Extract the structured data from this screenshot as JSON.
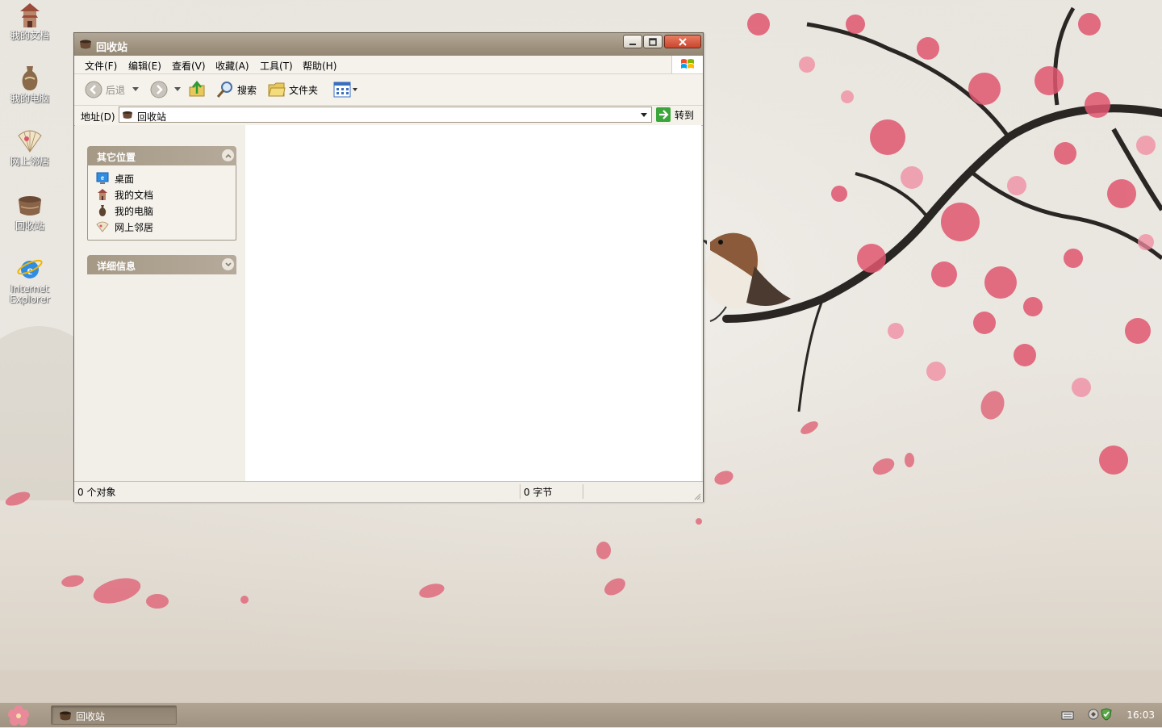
{
  "desktop": {
    "icons": [
      {
        "label": "我的文档"
      },
      {
        "label": "我的电脑"
      },
      {
        "label": "网上邻居"
      },
      {
        "label": "回收站"
      },
      {
        "label": "Internet Explorer"
      }
    ]
  },
  "window": {
    "title": "回收站",
    "menu": [
      "文件(F)",
      "编辑(E)",
      "查看(V)",
      "收藏(A)",
      "工具(T)",
      "帮助(H)"
    ],
    "toolbar": {
      "back": "后退",
      "search": "搜索",
      "folders": "文件夹"
    },
    "address": {
      "label": "地址(D)",
      "value": "回收站",
      "go": "转到"
    },
    "taskpane": {
      "other_places": {
        "title": "其它位置",
        "links": [
          "桌面",
          "我的文档",
          "我的电脑",
          "网上邻居"
        ]
      },
      "details": {
        "title": "详细信息"
      }
    },
    "status": {
      "objects": "0 个对象",
      "bytes": "0 字节"
    }
  },
  "taskbar": {
    "task": "回收站",
    "clock": "16:03"
  },
  "colors": {
    "titlebar": "#a29683",
    "taskbar": "#a89a88",
    "blossom": "#e0566f"
  }
}
